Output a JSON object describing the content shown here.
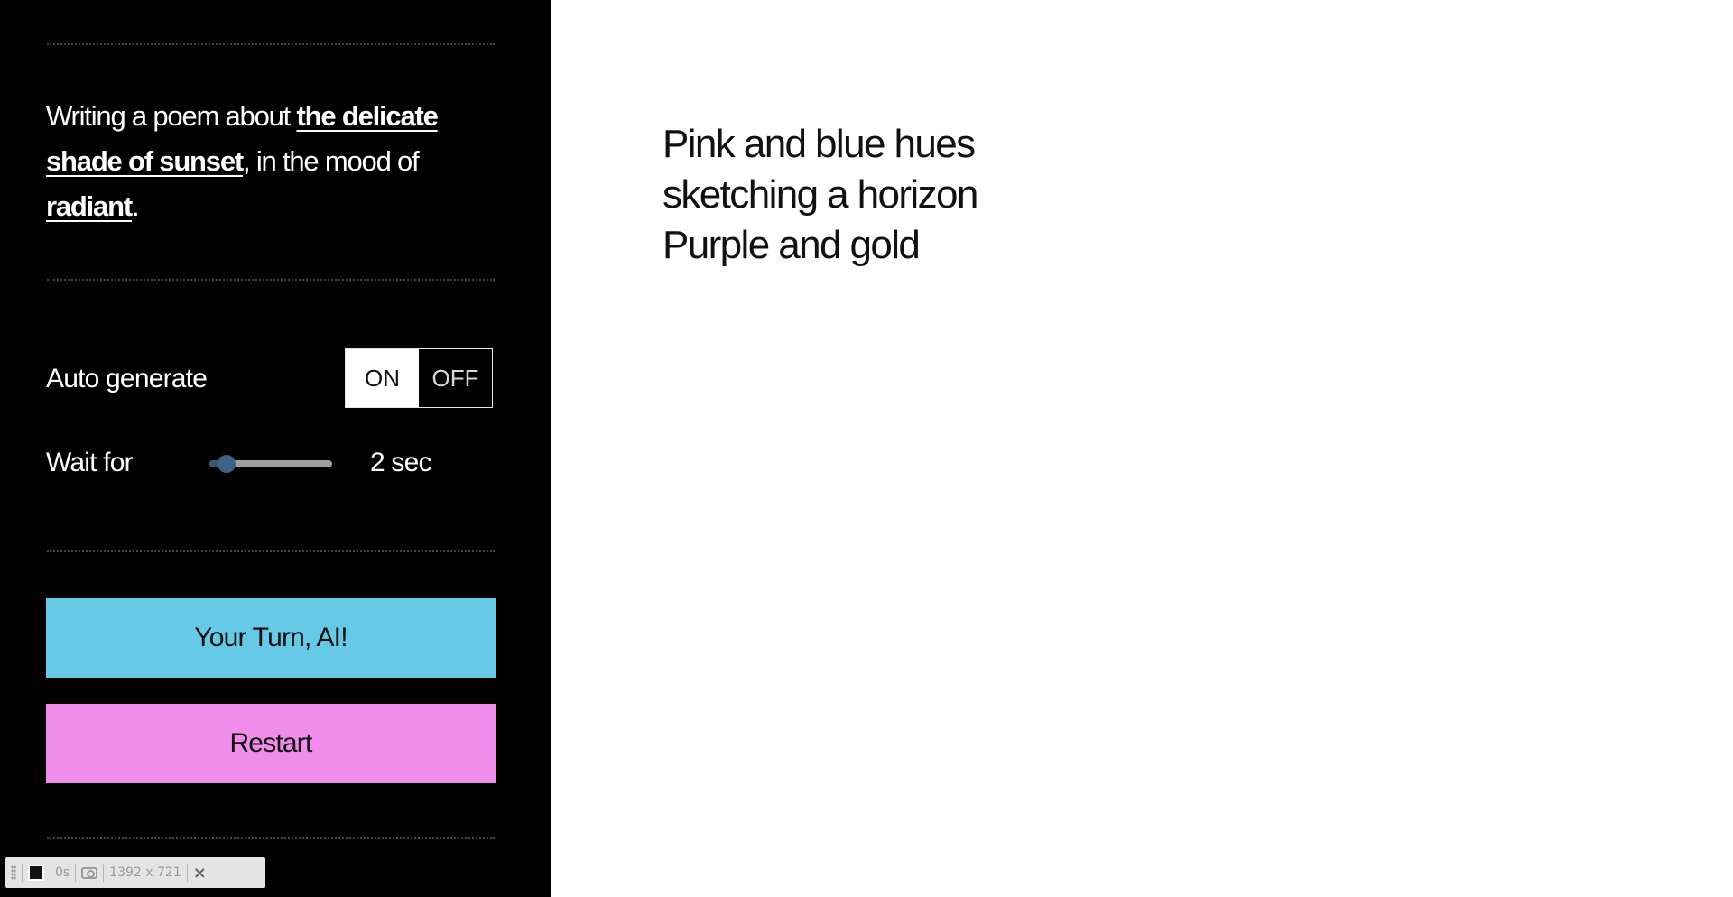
{
  "prompt": {
    "prefix": "Writing a poem about ",
    "topic": "the delicate shade of sunset",
    "middle": ", in the mood of ",
    "mood": "radiant",
    "suffix": "."
  },
  "auto_generate": {
    "label": "Auto generate",
    "on_label": "ON",
    "off_label": "OFF",
    "selected": "ON"
  },
  "wait": {
    "label": "Wait for",
    "value_label": "2 sec",
    "slider_fraction": 0.14
  },
  "buttons": {
    "your_turn": "Your Turn, AI!",
    "restart": "Restart"
  },
  "poem": {
    "lines": [
      "Pink and blue hues",
      "sketching a horizon",
      "Purple and gold"
    ]
  },
  "devbar": {
    "time": "0s",
    "viewport": "1392 x 721",
    "close": "×"
  },
  "colors": {
    "panel_bg": "#000000",
    "ai_button": "#66c9e6",
    "restart_button": "#f08ce9",
    "slider_accent": "#3b6384"
  },
  "icons": {
    "drag": "grip-icon",
    "record": "record-square-icon",
    "screenshot": "camera-icon",
    "close": "close-icon"
  }
}
